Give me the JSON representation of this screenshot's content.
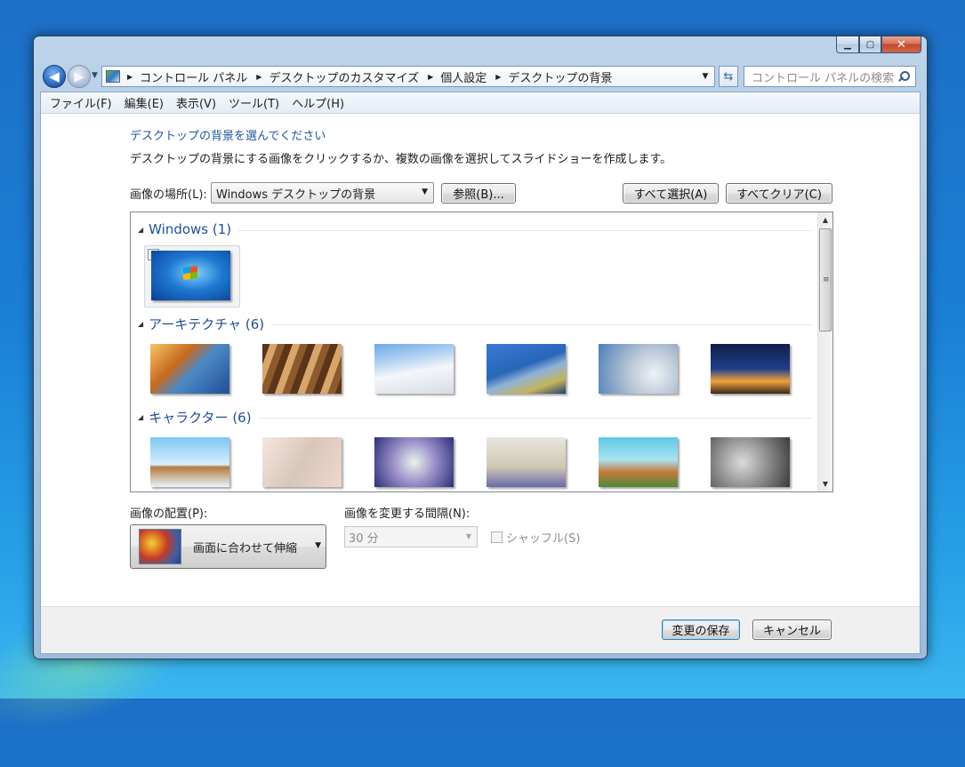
{
  "window": {
    "caption_buttons": {
      "minimize": "▁",
      "maximize": "▢",
      "close": "✕"
    }
  },
  "navigation": {
    "breadcrumbs": [
      "コントロール パネル",
      "デスクトップのカスタマイズ",
      "個人設定",
      "デスクトップの背景"
    ],
    "search_placeholder": "コントロール パネルの検索"
  },
  "menu": [
    "ファイル(F)",
    "編集(E)",
    "表示(V)",
    "ツール(T)",
    "ヘルプ(H)"
  ],
  "page": {
    "heading": "デスクトップの背景を選んでください",
    "description": "デスクトップの背景にする画像をクリックするか、複数の画像を選択してスライドショーを作成します。",
    "location_label": "画像の場所(L):",
    "location_value": "Windows デスクトップの背景",
    "browse_button": "参照(B)...",
    "select_all_button": "すべて選択(A)",
    "clear_all_button": "すべてクリア(C)"
  },
  "gallery": {
    "groups": [
      {
        "title": "Windows (1)",
        "items": [
          "Windows 7 背景"
        ],
        "checked": [
          true
        ]
      },
      {
        "title": "アーキテクチャ (6)",
        "items": [
          "アーキテクチャ 1",
          "アーキテクチャ 2",
          "アーキテクチャ 3",
          "アーキテクチャ 4",
          "アーキテクチャ 5",
          "アーキテクチャ 6"
        ]
      },
      {
        "title": "キャラクター (6)",
        "items": [
          "キャラクター 1",
          "キャラクター 2",
          "キャラクター 3",
          "キャラクター 4",
          "キャラクター 5",
          "キャラクター 6"
        ]
      }
    ]
  },
  "options": {
    "position_label": "画像の配置(P):",
    "position_value": "画面に合わせて伸縮",
    "interval_label": "画像を変更する間隔(N):",
    "interval_value": "30 分",
    "shuffle_label": "シャッフル(S)",
    "shuffle_checked": false
  },
  "footer": {
    "save_button": "変更の保存",
    "cancel_button": "キャンセル"
  }
}
